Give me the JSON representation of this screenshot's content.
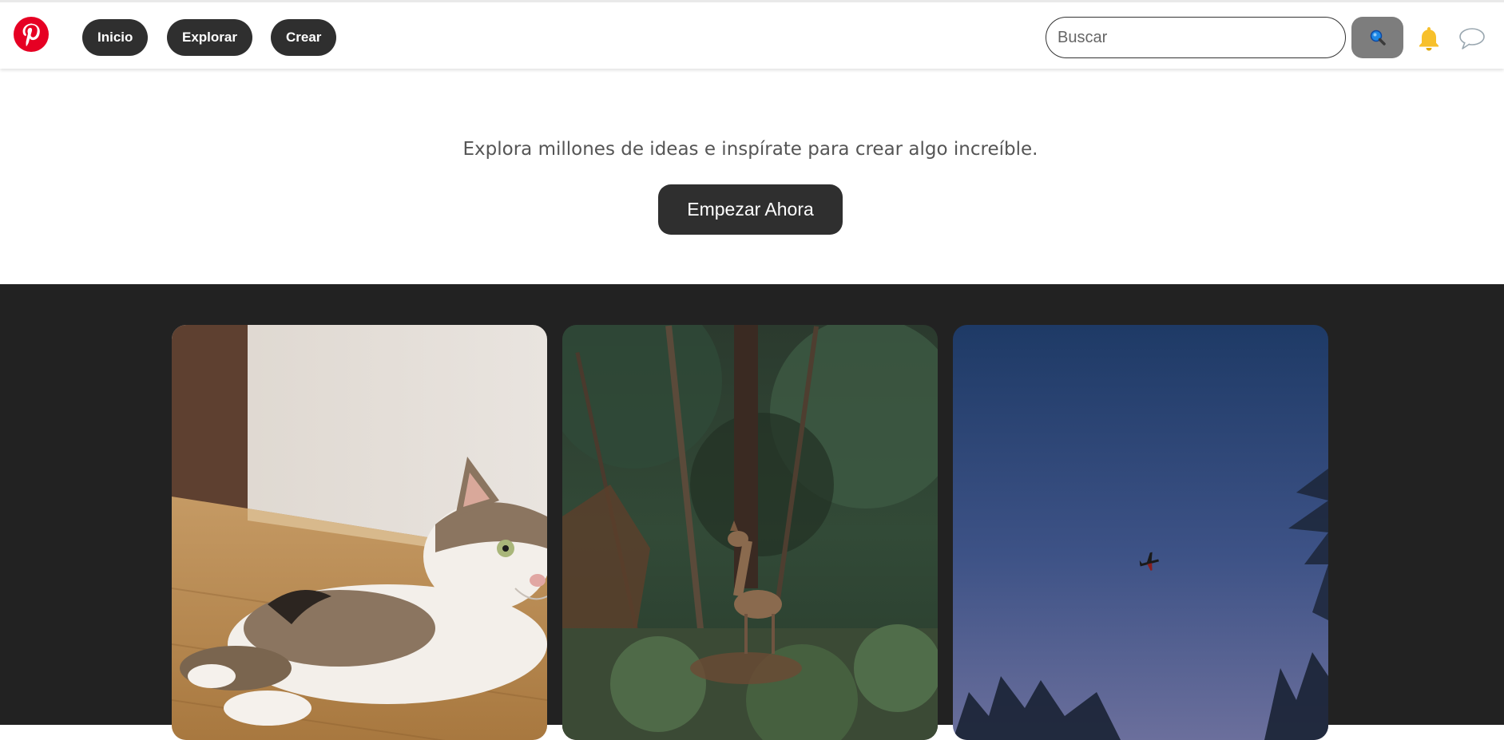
{
  "header": {
    "logo": "pinterest-logo",
    "nav": [
      {
        "label": "Inicio"
      },
      {
        "label": "Explorar"
      },
      {
        "label": "Crear"
      }
    ],
    "search": {
      "placeholder": "Buscar",
      "value": ""
    },
    "icons": [
      "search-icon",
      "bell-icon",
      "chat-bubble-icon"
    ],
    "colors": {
      "brand": "#e60023",
      "button": "#2f2f2f",
      "bell": "#f7c02b"
    }
  },
  "hero": {
    "text": "Explora millones de ideas e inspírate para crear algo increíble.",
    "cta_label": "Empezar Ahora"
  },
  "gallery": {
    "cards": [
      {
        "subject": "cat"
      },
      {
        "subject": "deer-in-forest"
      },
      {
        "subject": "airplane-in-evening-sky"
      }
    ],
    "background": "#222222"
  }
}
